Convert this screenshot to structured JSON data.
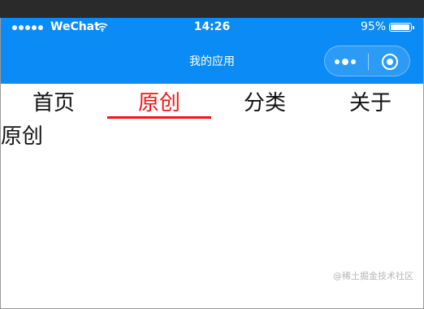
{
  "status_bar": {
    "carrier": "WeChat",
    "time": "14:26",
    "battery": "95%",
    "battery_level": 0.95,
    "signal_icon": "signal-dots-icon",
    "wifi_icon": "wifi-icon"
  },
  "nav_bar": {
    "title": "我的应用",
    "more_icon": "more-dots-icon",
    "close_icon": "target-close-icon"
  },
  "tabs": [
    {
      "label": "首页",
      "active": false
    },
    {
      "label": "原创",
      "active": true
    },
    {
      "label": "分类",
      "active": false
    },
    {
      "label": "关于",
      "active": false
    }
  ],
  "content": {
    "text": "原创"
  },
  "watermark": "@稀土掘金技术社区",
  "colors": {
    "brand_blue": "#0a8bf5",
    "active_tab": "#f01414",
    "text": "#111111"
  }
}
